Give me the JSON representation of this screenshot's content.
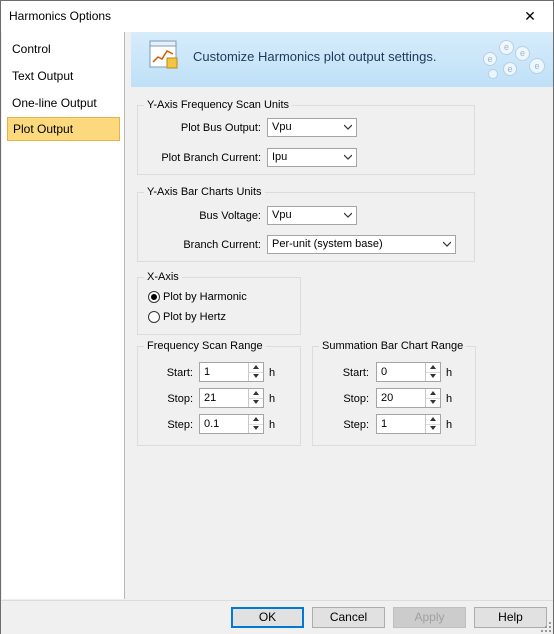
{
  "window": {
    "title": "Harmonics Options",
    "close_glyph": "✕"
  },
  "sidebar": {
    "items": [
      {
        "label": "Control"
      },
      {
        "label": "Text Output"
      },
      {
        "label": "One-line Output"
      },
      {
        "label": "Plot Output",
        "selected": true
      }
    ]
  },
  "banner": {
    "text": "Customize Harmonics plot output settings.",
    "icon": "chart-settings-icon",
    "deco_glyph": "e"
  },
  "freq_scan_units": {
    "legend": "Y-Axis Frequency Scan Units",
    "bus_output_label": "Plot Bus Output:",
    "bus_output_value": "Vpu",
    "branch_current_label": "Plot Branch Current:",
    "branch_current_value": "Ipu"
  },
  "bar_chart_units": {
    "legend": "Y-Axis Bar Charts Units",
    "bus_voltage_label": "Bus Voltage:",
    "bus_voltage_value": "Vpu",
    "branch_current_label": "Branch Current:",
    "branch_current_value": "Per-unit (system base)"
  },
  "x_axis": {
    "legend": "X-Axis",
    "options": [
      {
        "label": "Plot by Harmonic",
        "checked": true
      },
      {
        "label": "Plot by Hertz",
        "checked": false
      }
    ]
  },
  "freq_scan_range": {
    "legend": "Frequency Scan Range",
    "start_label": "Start:",
    "start_value": "1",
    "stop_label": "Stop:",
    "stop_value": "21",
    "step_label": "Step:",
    "step_value": "0.1",
    "unit": "h"
  },
  "summation_range": {
    "legend": "Summation Bar Chart Range",
    "start_label": "Start:",
    "start_value": "0",
    "stop_label": "Stop:",
    "stop_value": "20",
    "step_label": "Step:",
    "step_value": "1",
    "unit": "h"
  },
  "footer": {
    "ok": "OK",
    "cancel": "Cancel",
    "apply": "Apply",
    "help": "Help"
  },
  "colors": {
    "accent": "#0078d7",
    "selected_item": "#fcd97c",
    "banner": "#cfe8fa"
  }
}
